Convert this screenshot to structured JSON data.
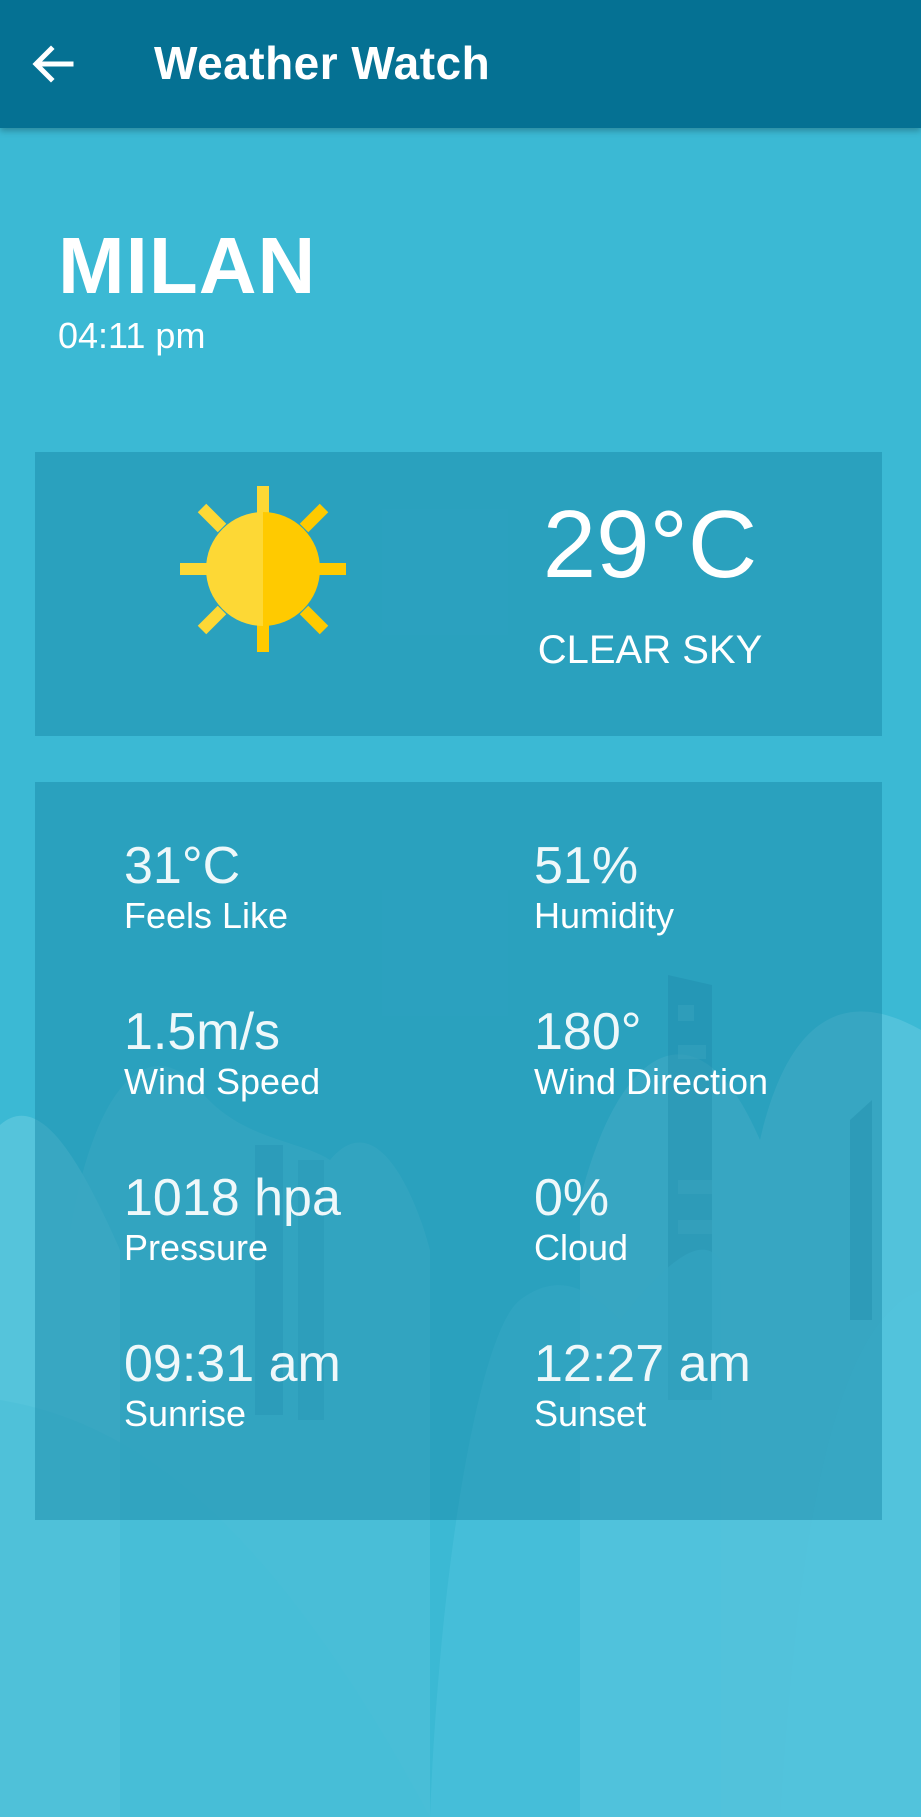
{
  "appbar": {
    "title": "Weather Watch",
    "back_icon": "arrow-left-icon"
  },
  "location": {
    "city": "MILAN",
    "time": "04:11 pm"
  },
  "current": {
    "temperature": "29°C",
    "description": "CLEAR SKY",
    "icon": "sun-icon"
  },
  "details": [
    {
      "value": "31°C",
      "label": "Feels Like"
    },
    {
      "value": "51%",
      "label": "Humidity"
    },
    {
      "value": "1.5m/s",
      "label": "Wind Speed"
    },
    {
      "value": "180°",
      "label": "Wind Direction"
    },
    {
      "value": "1018 hpa",
      "label": "Pressure"
    },
    {
      "value": "0%",
      "label": "Cloud"
    },
    {
      "value": "09:31 am",
      "label": "Sunrise"
    },
    {
      "value": "12:27 am",
      "label": "Sunset"
    }
  ],
  "colors": {
    "appbar": "#057193",
    "background": "#3bb9d4",
    "sun_light": "#fdd835",
    "sun_dark": "#ffca00"
  }
}
